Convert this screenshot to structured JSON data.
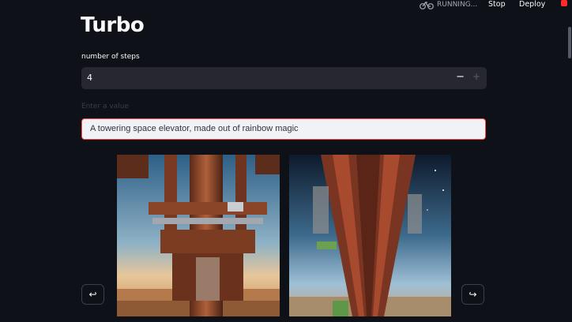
{
  "header": {
    "status_text": "RUNNING...",
    "status_icon": "bicycle-icon",
    "stop_label": "Stop",
    "deploy_label": "Deploy",
    "menu_icon": "main-menu-icon"
  },
  "main": {
    "title": "Turbo",
    "steps": {
      "label": "number of steps",
      "value": "4",
      "decrement_symbol": "−",
      "increment_symbol": "+"
    },
    "prompt": {
      "label": "Enter a value",
      "value": "A towering space elevator, made out of rainbow magic"
    },
    "gallery": {
      "prev_symbol": "↩",
      "next_symbol": "↪",
      "images": [
        "space-elevator-image-1",
        "space-elevator-image-2"
      ]
    }
  },
  "colors": {
    "background": "#0e1117",
    "input_background": "#262730",
    "accent": "#ff4b4b"
  }
}
